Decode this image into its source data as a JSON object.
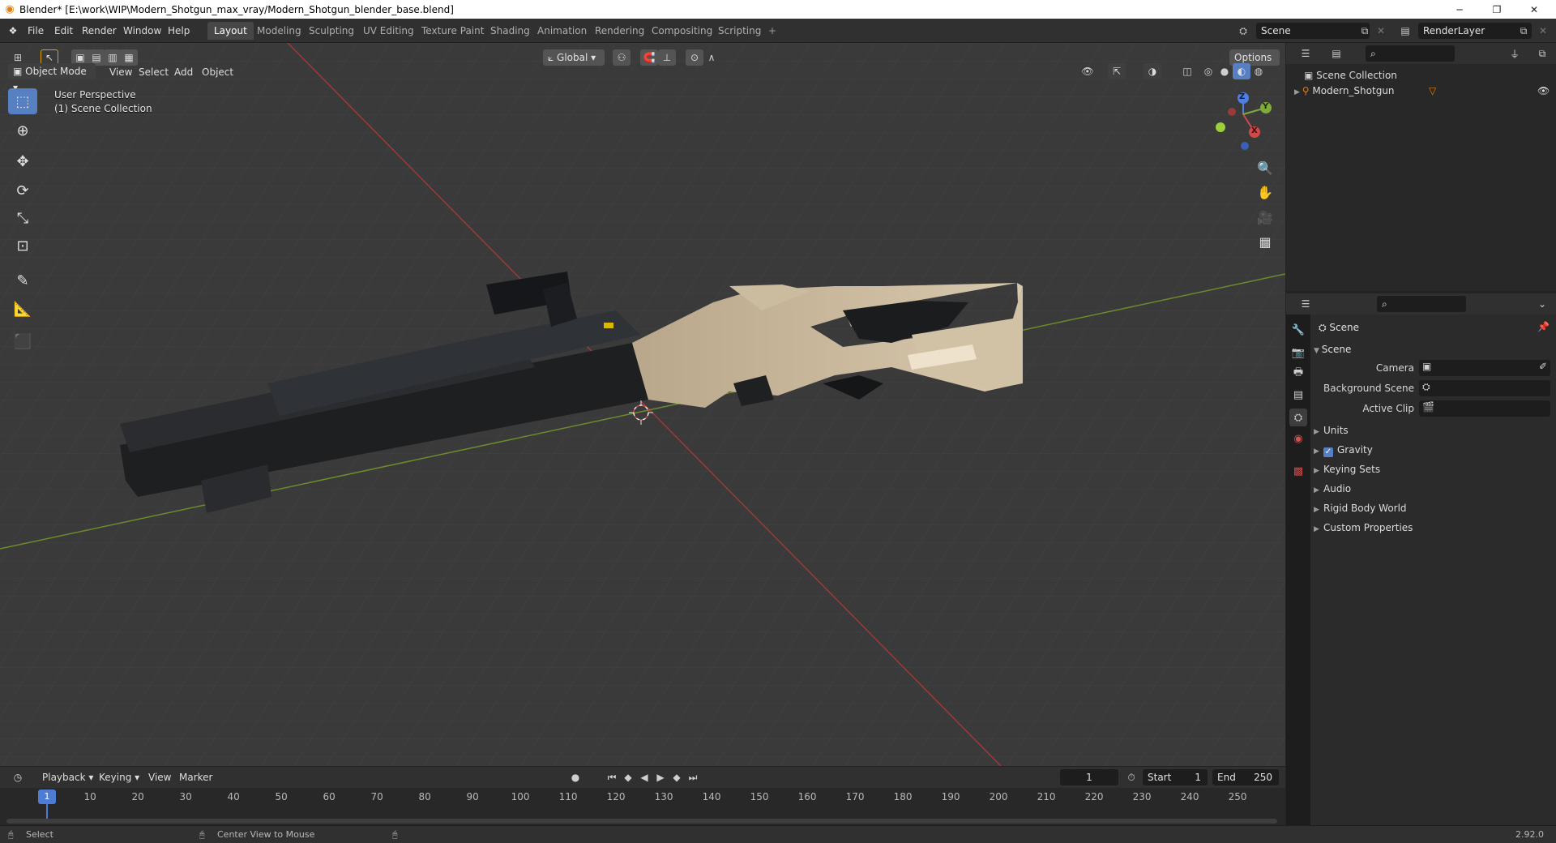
{
  "window": {
    "title": "Blender* [E:\\work\\WIP\\Modern_Shotgun_max_vray/Modern_Shotgun_blender_base.blend]",
    "minimize": "─",
    "maximize": "❐",
    "close": "✕"
  },
  "menu": [
    "File",
    "Edit",
    "Render",
    "Window",
    "Help"
  ],
  "workspaces": [
    {
      "label": "Layout",
      "active": true
    },
    {
      "label": "Modeling",
      "active": false
    },
    {
      "label": "Sculpting",
      "active": false
    },
    {
      "label": "UV Editing",
      "active": false
    },
    {
      "label": "Texture Paint",
      "active": false
    },
    {
      "label": "Shading",
      "active": false
    },
    {
      "label": "Animation",
      "active": false
    },
    {
      "label": "Rendering",
      "active": false
    },
    {
      "label": "Compositing",
      "active": false
    },
    {
      "label": "Scripting",
      "active": false
    }
  ],
  "add_workspace": "+",
  "scene_selector": "Scene",
  "render_layer": "RenderLayer",
  "viewport": {
    "mode": "Object Mode",
    "menus": [
      "View",
      "Select",
      "Add",
      "Object"
    ],
    "orientation": "Global",
    "options_label": "Options",
    "perspective_label": "User Perspective",
    "collection_label": "(1) Scene Collection",
    "gizmo": {
      "x": "X",
      "y": "Y",
      "z": "Z"
    }
  },
  "outliner": {
    "root": "Scene Collection",
    "items": [
      {
        "label": "Modern_Shotgun"
      }
    ]
  },
  "properties": {
    "context_label": "Scene",
    "section": "Scene",
    "rows": [
      {
        "label": "Camera"
      },
      {
        "label": "Background Scene"
      },
      {
        "label": "Active Clip"
      }
    ],
    "panels": [
      {
        "label": "Units",
        "checkbox": false
      },
      {
        "label": "Gravity",
        "checkbox": true
      },
      {
        "label": "Keying Sets",
        "checkbox": false
      },
      {
        "label": "Audio",
        "checkbox": false
      },
      {
        "label": "Rigid Body World",
        "checkbox": false
      },
      {
        "label": "Custom Properties",
        "checkbox": false
      }
    ]
  },
  "timeline": {
    "menus": [
      "Playback",
      "Keying",
      "View",
      "Marker"
    ],
    "current_frame": "1",
    "start_label": "Start",
    "start_value": "1",
    "end_label": "End",
    "end_value": "250",
    "playhead_label": "1",
    "ticks": [
      "10",
      "20",
      "30",
      "40",
      "50",
      "60",
      "70",
      "80",
      "90",
      "100",
      "110",
      "120",
      "130",
      "140",
      "150",
      "160",
      "170",
      "180",
      "190",
      "200",
      "210",
      "220",
      "230",
      "240",
      "250"
    ]
  },
  "status": {
    "select": "Select",
    "center_view": "Center View to Mouse",
    "version": "2.92.0"
  },
  "colors": {
    "accent": "#5680c2",
    "x_axis": "#d04848",
    "y_axis": "#7fab3a",
    "orange": "#e87d0d"
  }
}
